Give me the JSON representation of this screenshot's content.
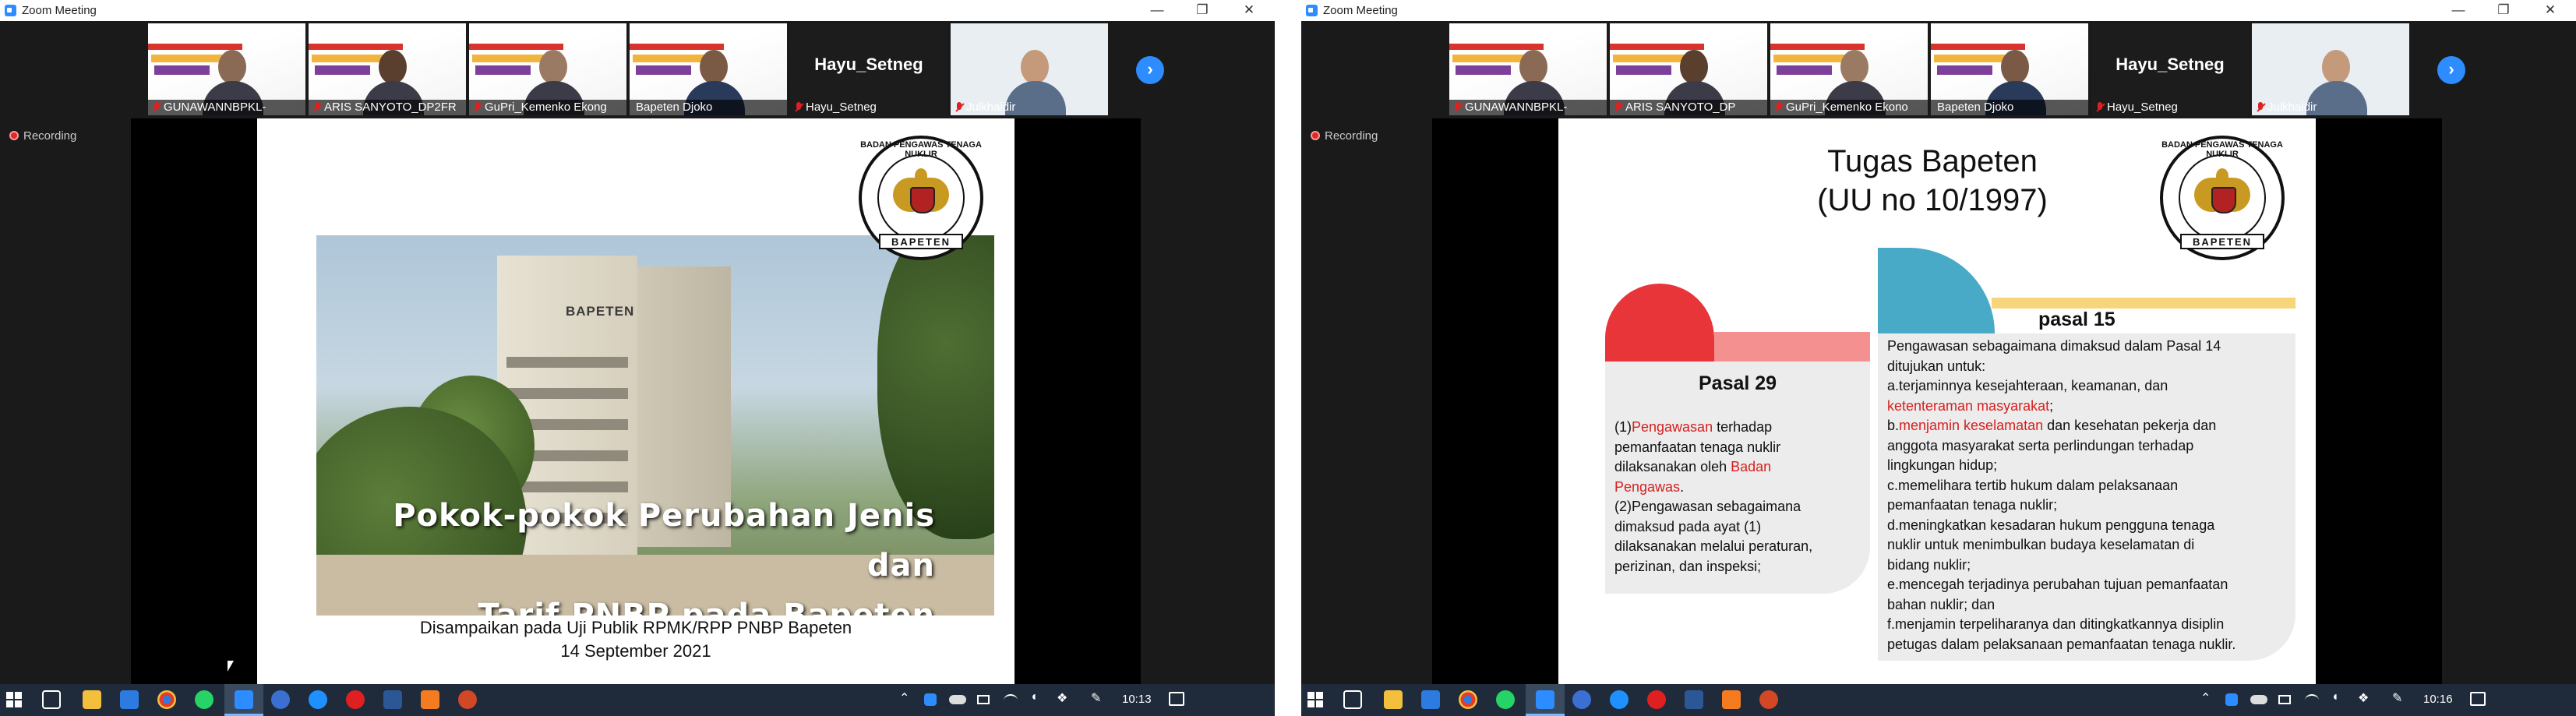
{
  "app": {
    "title": "Zoom Meeting",
    "minimize": "—",
    "maximize": "❐",
    "close": "✕"
  },
  "recording_label": "Recording",
  "participants": [
    {
      "name": "GUNAWANNBPKL-",
      "muted": true
    },
    {
      "name": "ARIS SANYOTO_DP2FR",
      "muted": true
    },
    {
      "name": "GuPri_Kemenko Ekong",
      "muted": true
    },
    {
      "name": "Bapeten Djoko",
      "muted": false,
      "active": true
    },
    {
      "name": "Hayu_Setneg",
      "muted": true,
      "display_name": "Hayu_Setneg"
    },
    {
      "name": "Julkhaidir",
      "muted": true
    }
  ],
  "participants_right": [
    {
      "name": "GUNAWANNBPKL-"
    },
    {
      "name": "ARIS SANYOTO_DP"
    },
    {
      "name": "GuPri_Kemenko Ekono"
    },
    {
      "name": "Bapeten Djoko"
    },
    {
      "name": "Hayu_Setneg",
      "display_name": "Hayu_Setneg"
    },
    {
      "name": "Julkhaidir"
    }
  ],
  "left_slide": {
    "logo_ribbon": "BAPETEN",
    "logo_arc": "BADAN PENGAWAS TENAGA NUKLIR",
    "building_sign": "BAPETEN",
    "title_line1": "Pokok-pokok Perubahan Jenis dan",
    "title_line2": "Tarif PNBP pada Bapeten",
    "subtitle_line1": "Disampaikan pada Uji Publik RPMK/RPP PNBP Bapeten",
    "subtitle_line2": "14 September 2021"
  },
  "right_slide": {
    "title_line1": "Tugas Bapeten",
    "title_line2": "(UU no 10/1997)",
    "logo_ribbon": "BAPETEN",
    "logo_arc": "BADAN PENGAWAS TENAGA NUKLIR",
    "pasal29": {
      "heading": "Pasal 29",
      "l1a": "(1)",
      "l1b": "Pengawasan",
      "l1c": " terhadap",
      "l2": "pemanfaatan tenaga nuklir",
      "l3a": "dilaksanakan oleh ",
      "l3b": "Badan",
      "l4a": "Pengawas",
      "l4b": ".",
      "l5": "(2)Pengawasan sebagaimana",
      "l6": "dimaksud pada ayat (1)",
      "l7": "dilaksanakan melalui peraturan,",
      "l8": "perizinan, dan inspeksi;"
    },
    "pasal15": {
      "heading": "pasal 15",
      "l1": "Pengawasan sebagaimana dimaksud dalam Pasal 14",
      "l2": "ditujukan untuk:",
      "l3": "a.terjaminnya kesejahteraan, keamanan, dan",
      "l4a": "ketenteraman masyarakat",
      "l4b": ";",
      "l5a": "b.",
      "l5b": "menjamin keselamatan",
      "l5c": " dan kesehatan pekerja dan",
      "l6": "anggota masyarakat serta perlindungan terhadap",
      "l7": "lingkungan hidup;",
      "l8": "c.memelihara tertib hukum dalam pelaksanaan",
      "l9": "pemanfaatan tenaga nuklir;",
      "l10": "d.meningkatkan kesadaran hukum pengguna tenaga",
      "l11": "nuklir untuk menimbulkan budaya keselamatan di",
      "l12": "bidang nuklir;",
      "l13": "e.mencegah terjadinya perubahan tujuan pemanfaatan",
      "l14": "bahan nuklir; dan",
      "l15": "f.menjamin terpeliharanya dan ditingkatkannya disiplin",
      "l16": "petugas dalam pelaksanaan pemanfaatan tenaga nuklir."
    }
  },
  "taskbar": {
    "clock_left": "10:13",
    "clock_right": "10:16"
  },
  "colors": {
    "accent": "#2d8cff",
    "active_speaker": "#c8e63c",
    "slide_red": "#d71f1f",
    "taskbar": "#1f2b3a"
  }
}
